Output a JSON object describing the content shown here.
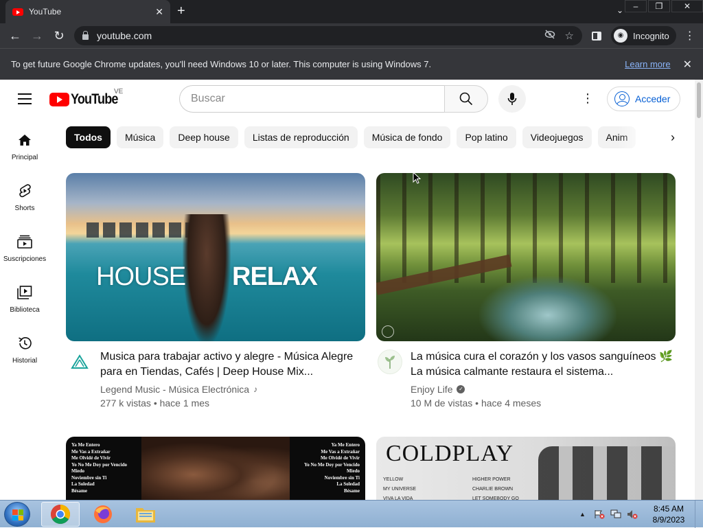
{
  "browser": {
    "tab_title": "YouTube",
    "url": "youtube.com",
    "incognito_label": "Incognito",
    "infobar_message": "To get future Google Chrome updates, you'll need Windows 10 or later. This computer is using Windows 7.",
    "infobar_link": "Learn more"
  },
  "masthead": {
    "logo_text": "YouTube",
    "region": "VE",
    "search_placeholder": "Buscar",
    "signin_label": "Acceder"
  },
  "guide": {
    "items": [
      {
        "label": "Principal",
        "icon": "home-icon"
      },
      {
        "label": "Shorts",
        "icon": "shorts-icon"
      },
      {
        "label": "Suscripciones",
        "icon": "subscriptions-icon"
      },
      {
        "label": "Biblioteca",
        "icon": "library-icon"
      },
      {
        "label": "Historial",
        "icon": "history-icon"
      }
    ]
  },
  "chips": [
    "Todos",
    "Música",
    "Deep house",
    "Listas de reproducción",
    "Música de fondo",
    "Pop latino",
    "Videojuegos",
    "Anim"
  ],
  "videos": [
    {
      "thumb_text_left": "HOUSE",
      "thumb_text_right": "RELAX",
      "title": "Musica para trabajar activo y alegre - Música Alegre para en Tiendas, Cafés | Deep House Mix...",
      "channel": "Legend Music - Música Electrónica",
      "stats": "277 k vistas • hace 1 mes"
    },
    {
      "title": "La música cura el corazón y los vasos sanguíneos 🌿 La música calmante restaura el sistema...",
      "channel": "Enjoy Life",
      "stats": "10 M de vistas • hace 4 meses"
    },
    {
      "thumb_lines_left": [
        "Ya Me Entero",
        "Me Vas a Extrañar",
        "Me Olvidé de Vivir",
        "Yo No Me Doy por Vencido",
        "Miedo",
        "Noviembre sin Ti",
        "La Soledad",
        "Bésame"
      ],
      "thumb_lines_right": [
        "Ya Me Entero",
        "Me Vas a Extrañar",
        "Me Olvidé de Vivir",
        "Yo No Me Doy por Vencido",
        "Miedo",
        "Noviembre sin Ti",
        "La Soledad",
        "Bésame"
      ]
    },
    {
      "thumb_title": "COLDPLAY",
      "thumb_songs_left": [
        "YELLOW",
        "MY UNIVERSE",
        "VIVA LA VIDA"
      ],
      "thumb_songs_right": [
        "HIGHER POWER",
        "CHARLIE BROWN",
        "LET SOMEBODY GO"
      ]
    }
  ],
  "taskbar": {
    "time": "8:45 AM",
    "date": "8/9/2023"
  },
  "colors": {
    "youtube_red": "#ff0000",
    "link_blue": "#065fd4",
    "chrome_dark": "#35363a"
  }
}
